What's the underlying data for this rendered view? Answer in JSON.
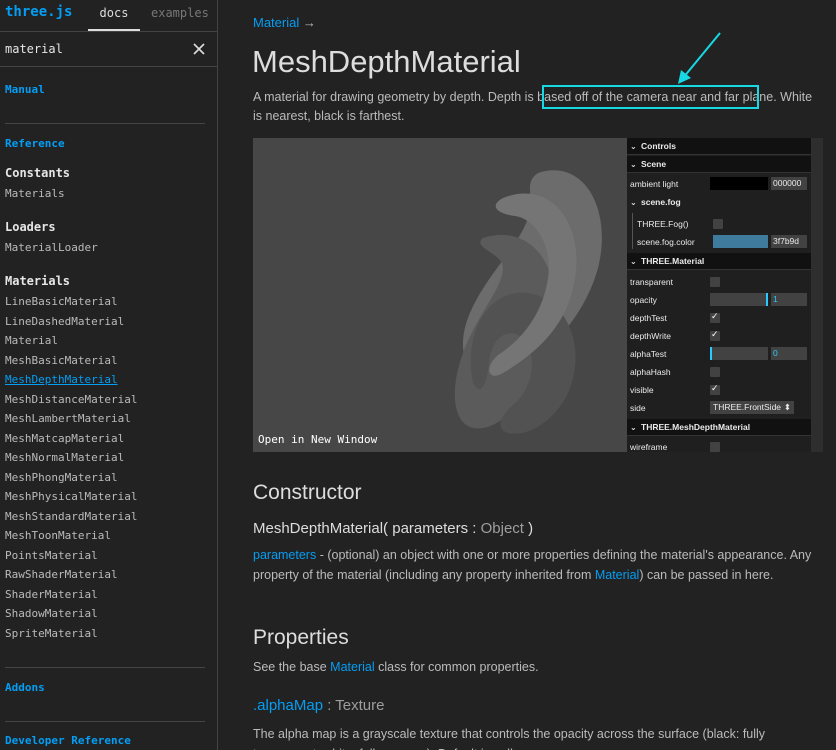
{
  "sidebar": {
    "logo": "three.js",
    "tabs": {
      "docs": "docs",
      "examples": "examples"
    },
    "search": {
      "value": "material",
      "placeholder": ""
    },
    "sections": {
      "manual": "Manual",
      "reference": "Reference",
      "constants": "Constants",
      "constants_items": [
        "Materials"
      ],
      "loaders": "Loaders",
      "loaders_items": [
        "MaterialLoader"
      ],
      "materials": "Materials",
      "materials_items": [
        "LineBasicMaterial",
        "LineDashedMaterial",
        "Material",
        "MeshBasicMaterial",
        "MeshDepthMaterial",
        "MeshDistanceMaterial",
        "MeshLambertMaterial",
        "MeshMatcapMaterial",
        "MeshNormalMaterial",
        "MeshPhongMaterial",
        "MeshPhysicalMaterial",
        "MeshStandardMaterial",
        "MeshToonMaterial",
        "PointsMaterial",
        "RawShaderMaterial",
        "ShaderMaterial",
        "ShadowMaterial",
        "SpriteMaterial"
      ],
      "active_item": "MeshDepthMaterial",
      "addons": "Addons",
      "developer_reference": "Developer Reference"
    }
  },
  "content": {
    "breadcrumb": "Material",
    "breadcrumb_arrow": "→",
    "title": "MeshDepthMaterial",
    "description": "A material for drawing geometry by depth. Depth is based off of the camera near and far plane. White is nearest, black is farthest.",
    "viewer": {
      "open_link": "Open in New Window",
      "gui": {
        "controls": "Controls",
        "scene": "Scene",
        "ambient_light_label": "ambient light",
        "ambient_light_value": "000000",
        "scene_fog": "scene.fog",
        "three_fog_label": "THREE.Fog()",
        "fog_color_label": "scene.fog.color",
        "fog_color_value": "3f7b9d",
        "three_material": "THREE.Material",
        "transparent_label": "transparent",
        "opacity_label": "opacity",
        "opacity_value": "1",
        "depth_test_label": "depthTest",
        "depth_write_label": "depthWrite",
        "alpha_test_label": "alphaTest",
        "alpha_test_value": "0",
        "alpha_hash_label": "alphaHash",
        "visible_label": "visible",
        "side_label": "side",
        "side_value": "THREE.FrontSide",
        "mesh_depth_material": "THREE.MeshDepthMaterial",
        "wireframe_label": "wireframe",
        "checks": {
          "transparent": false,
          "fog": false,
          "depth_test": true,
          "depth_write": true,
          "alpha_hash": false,
          "visible": true,
          "wireframe": false
        },
        "opacity_fraction": 1,
        "alpha_test_fraction": 0
      }
    },
    "constructor_heading": "Constructor",
    "signature": {
      "name": "MeshDepthMaterial(",
      "param": " parameters : ",
      "type": "Object",
      "close": " )"
    },
    "constructor_desc": {
      "param_link": "parameters",
      "text1": " - (optional) an object with one or more properties defining the material's appearance. Any property of the material (including any property inherited from ",
      "material_link": "Material",
      "text2": ") can be passed in here."
    },
    "properties_heading": "Properties",
    "properties_desc": {
      "text1": "See the base ",
      "link": "Material",
      "text2": " class for common properties."
    },
    "property": {
      "name": ".alphaMap",
      "type": " : Texture",
      "desc": "The alpha map is a grayscale texture that controls the opacity across the surface (black: fully transparent; white: fully opaque). Default is null."
    }
  },
  "colors": {
    "accent": "#049ef4",
    "highlight": "#16d9e3",
    "fog_color": "#3f7b9d"
  }
}
